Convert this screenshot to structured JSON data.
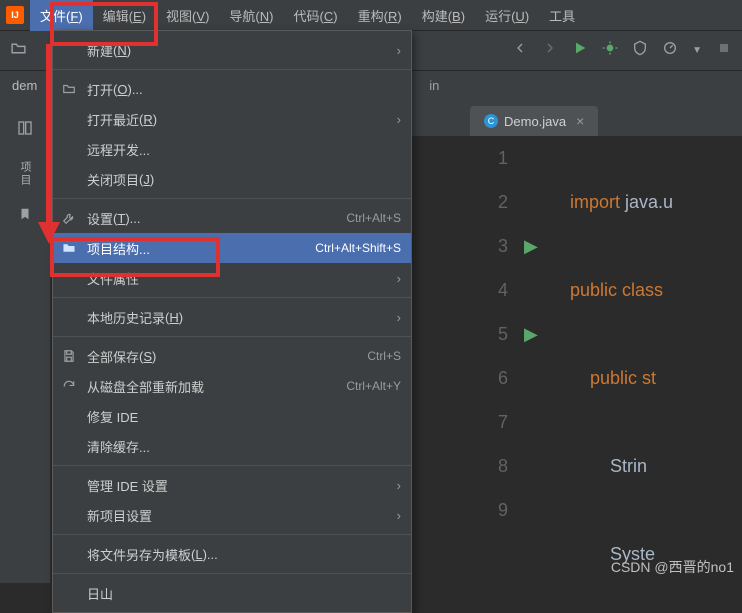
{
  "menubar": {
    "items": [
      {
        "label": "文件",
        "key": "F"
      },
      {
        "label": "编辑",
        "key": "E"
      },
      {
        "label": "视图",
        "key": "V"
      },
      {
        "label": "导航",
        "key": "N"
      },
      {
        "label": "代码",
        "key": "C"
      },
      {
        "label": "重构",
        "key": "R"
      },
      {
        "label": "构建",
        "key": "B"
      },
      {
        "label": "运行",
        "key": "U"
      },
      {
        "label": "工具"
      }
    ]
  },
  "project_tab": "dem",
  "breadcrumb_tail": "in",
  "vertical_label": "项目",
  "editor_tab": "Demo.java",
  "dropdown": {
    "new": "新建",
    "new_key": "N",
    "open": "打开",
    "open_key": "O",
    "recent": "打开最近",
    "recent_key": "R",
    "remote": "远程开发...",
    "close_project": "关闭项目",
    "close_key": "J",
    "settings": "设置",
    "settings_key": "T",
    "settings_kb": "Ctrl+Alt+S",
    "project_structure": "项目结构...",
    "project_structure_kb": "Ctrl+Alt+Shift+S",
    "file_props": "文件属性",
    "local_history": "本地历史记录",
    "local_history_key": "H",
    "save_all": "全部保存",
    "save_all_key": "S",
    "save_all_kb": "Ctrl+S",
    "reload_disk": "从磁盘全部重新加载",
    "reload_disk_kb": "Ctrl+Alt+Y",
    "repair": "修复 IDE",
    "invalidate": "清除缓存...",
    "manage_ide": "管理 IDE 设置",
    "new_project_settings": "新项目设置",
    "save_as_template": "将文件另存为模板",
    "save_as_template_key": "L",
    "exit_partial": "日山"
  },
  "code": {
    "line1_kw": "import",
    "line1_rest": " java.u",
    "line3": "public class ",
    "line5": "public st",
    "line7": "Strin",
    "line9": "Syste"
  },
  "line_numbers": [
    "1",
    "2",
    "3",
    "4",
    "5",
    "6",
    "7",
    "8",
    "9"
  ],
  "watermark": "CSDN @西晋的no1"
}
